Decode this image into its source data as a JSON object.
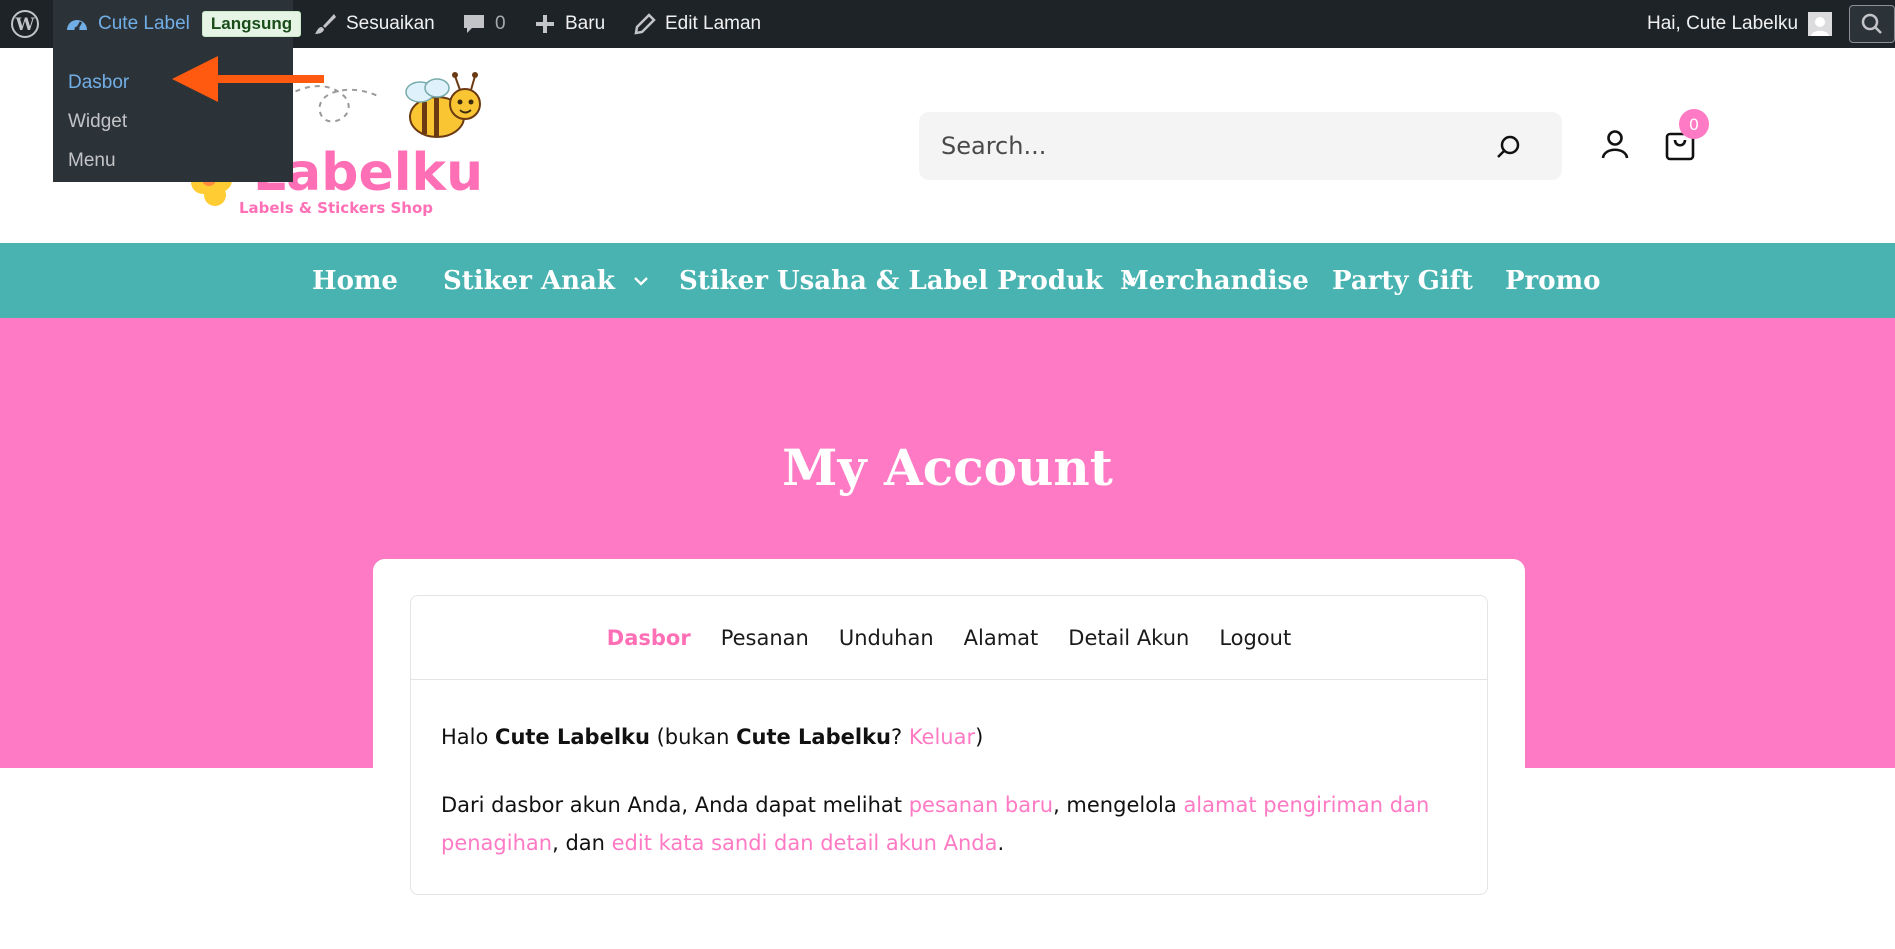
{
  "adminbar": {
    "site_name": "Cute Label",
    "status_badge": "Langsung",
    "customize": "Sesuaikan",
    "comments_count": "0",
    "new": "Baru",
    "edit_page": "Edit Laman",
    "greeting": "Hai, Cute Labelku"
  },
  "site_menu": [
    "Dasbor",
    "Widget",
    "Menu"
  ],
  "logo": {
    "tagline": "Labels & Stickers Shop"
  },
  "header": {
    "search_placeholder": "Search...",
    "cart_count": "0"
  },
  "nav": [
    {
      "label": "Home"
    },
    {
      "label": "Stiker Anak"
    },
    {
      "label": "Stiker Usaha & Label Produk"
    },
    {
      "label": "Merchandise"
    },
    {
      "label": "Party Gift"
    },
    {
      "label": "Promo"
    }
  ],
  "page_title": "My Account",
  "tabs": [
    "Dasbor",
    "Pesanan",
    "Unduhan",
    "Alamat",
    "Detail Akun",
    "Logout"
  ],
  "greeting": {
    "hello": "Halo ",
    "user": "Cute Labelku",
    "not_prefix": " (bukan ",
    "user2": "Cute Labelku",
    "question": "? ",
    "logout_link": "Keluar",
    "close": ")"
  },
  "intro": {
    "text1": "Dari dasbor akun Anda, Anda dapat melihat ",
    "link_orders": "pesanan baru",
    "text2": ", mengelola ",
    "link_addresses": "alamat pengiriman dan penagihan",
    "text3": ", dan ",
    "link_account": "edit kata sandi dan detail akun Anda",
    "text4": "."
  },
  "colors": {
    "admin_bar": "#1d2327",
    "nav": "#48b3b1",
    "hero": "#ff7ac4",
    "accent_link": "#ff7ac4",
    "annotation_arrow": "#ff5a10"
  }
}
